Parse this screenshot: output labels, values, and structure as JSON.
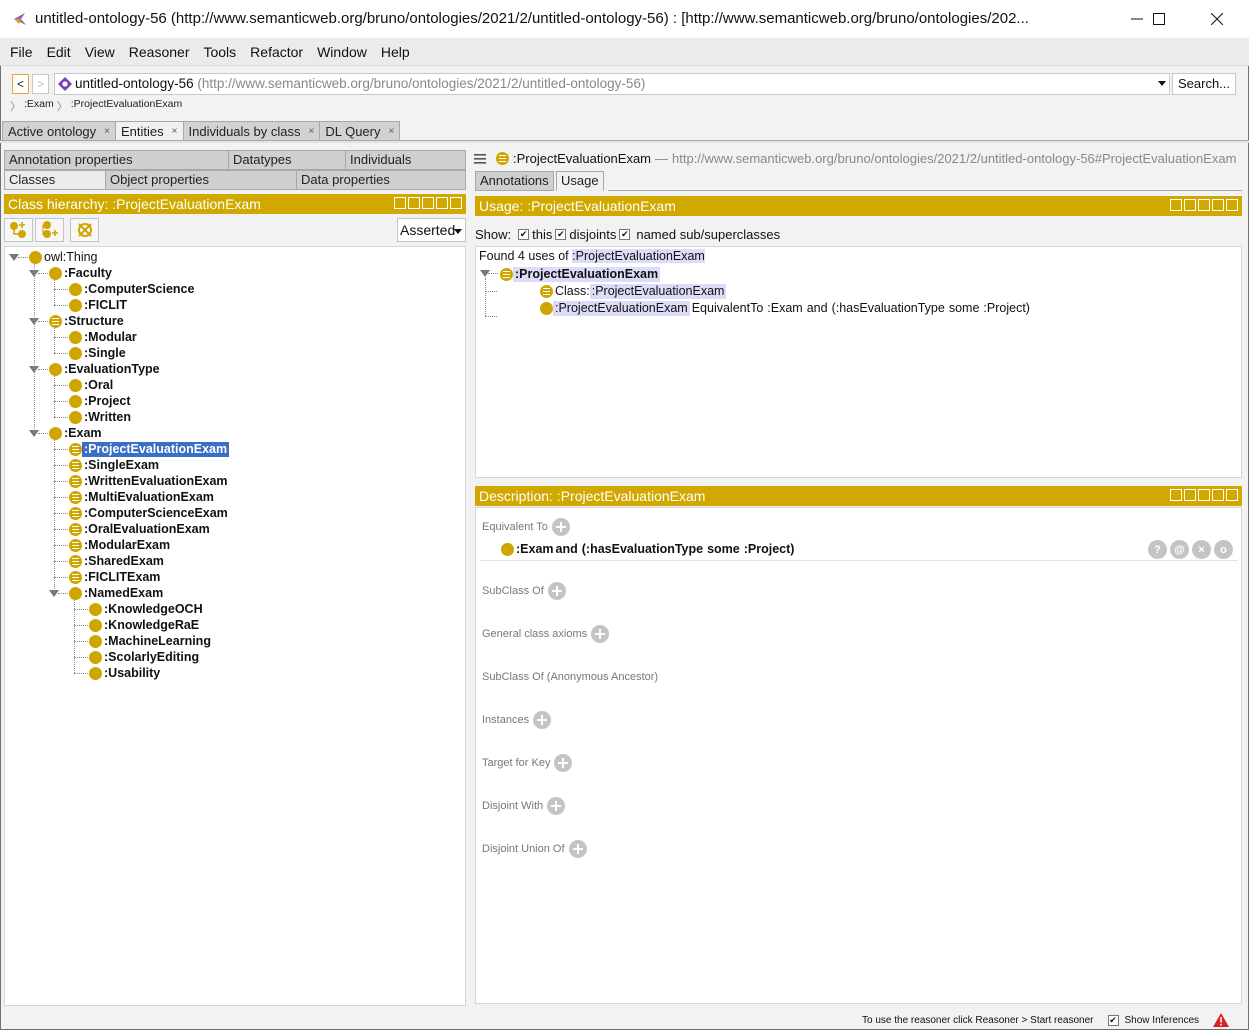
{
  "window": {
    "title": "untitled-ontology-56 (http://www.semanticweb.org/bruno/ontologies/2021/2/untitled-ontology-56)  : [http://www.semanticweb.org/bruno/ontologies/202...",
    "controls": [
      "minimize-icon",
      "maximize-icon",
      "close-icon"
    ]
  },
  "menubar": [
    "File",
    "Edit",
    "View",
    "Reasoner",
    "Tools",
    "Refactor",
    "Window",
    "Help"
  ],
  "navigation": {
    "back": "<",
    "forward": ">",
    "ontology_name": "untitled-ontology-56",
    "ontology_iri": "(http://www.semanticweb.org/bruno/ontologies/2021/2/untitled-ontology-56)",
    "search_label": "Search..."
  },
  "breadcrumb": [
    ":Exam",
    ":ProjectEvaluationExam"
  ],
  "workspace_tabs": [
    {
      "label": "Active ontology",
      "active": false
    },
    {
      "label": "Entities",
      "active": true
    },
    {
      "label": "Individuals by class",
      "active": false
    },
    {
      "label": "DL Query",
      "active": false
    }
  ],
  "entity_tabs": {
    "row1": [
      "Annotation properties",
      "Datatypes",
      "Individuals"
    ],
    "row2": [
      "Classes",
      "Object properties",
      "Data properties"
    ],
    "active": "Classes"
  },
  "class_hierarchy": {
    "header": "Class hierarchy: :ProjectEvaluationExam",
    "mode": "Asserted",
    "tools": [
      "add-subclass-icon",
      "add-sibling-class-icon",
      "delete-class-icon"
    ],
    "tree": [
      {
        "label": "owl:Thing",
        "depth": 0,
        "expanded": true,
        "bold": false,
        "defined": false
      },
      {
        "label": ":Faculty",
        "depth": 1,
        "expanded": true,
        "defined": false
      },
      {
        "label": ":ComputerScience",
        "depth": 2,
        "defined": false
      },
      {
        "label": ":FICLIT",
        "depth": 2,
        "defined": false
      },
      {
        "label": ":Structure",
        "depth": 1,
        "expanded": true,
        "defined": true
      },
      {
        "label": ":Modular",
        "depth": 2,
        "defined": false
      },
      {
        "label": ":Single",
        "depth": 2,
        "defined": false
      },
      {
        "label": ":EvaluationType",
        "depth": 1,
        "expanded": true,
        "defined": false
      },
      {
        "label": ":Oral",
        "depth": 2,
        "defined": false
      },
      {
        "label": ":Project",
        "depth": 2,
        "defined": false
      },
      {
        "label": ":Written",
        "depth": 2,
        "defined": false
      },
      {
        "label": ":Exam",
        "depth": 1,
        "expanded": true,
        "defined": false
      },
      {
        "label": ":ProjectEvaluationExam",
        "depth": 2,
        "defined": true,
        "selected": true
      },
      {
        "label": ":SingleExam",
        "depth": 2,
        "defined": true
      },
      {
        "label": ":WrittenEvaluationExam",
        "depth": 2,
        "defined": true
      },
      {
        "label": ":MultiEvaluationExam",
        "depth": 2,
        "defined": true
      },
      {
        "label": ":ComputerScienceExam",
        "depth": 2,
        "defined": true
      },
      {
        "label": ":OralEvaluationExam",
        "depth": 2,
        "defined": true
      },
      {
        "label": ":ModularExam",
        "depth": 2,
        "defined": true
      },
      {
        "label": ":SharedExam",
        "depth": 2,
        "defined": true
      },
      {
        "label": ":FICLITExam",
        "depth": 2,
        "defined": true
      },
      {
        "label": ":NamedExam",
        "depth": 2,
        "expanded": true,
        "defined": false
      },
      {
        "label": ":KnowledgeOCH",
        "depth": 3,
        "defined": false
      },
      {
        "label": ":KnowledgeRaE",
        "depth": 3,
        "defined": false
      },
      {
        "label": ":MachineLearning",
        "depth": 3,
        "defined": false
      },
      {
        "label": ":ScolarlyEditing",
        "depth": 3,
        "defined": false
      },
      {
        "label": ":Usability",
        "depth": 3,
        "defined": false
      }
    ]
  },
  "entity": {
    "name": ":ProjectEvaluationExam",
    "separator": "—",
    "iri": "http://www.semanticweb.org/bruno/ontologies/2021/2/untitled-ontology-56#ProjectEvaluationExam"
  },
  "right_tabs": [
    {
      "label": "Annotations",
      "active": false
    },
    {
      "label": "Usage",
      "active": true
    }
  ],
  "usage": {
    "header": "Usage: :ProjectEvaluationExam",
    "show_label": "Show:",
    "options": [
      {
        "label": "this",
        "checked": true
      },
      {
        "label": "disjoints",
        "checked": true
      },
      {
        "label": "named sub/superclasses",
        "checked": true
      }
    ],
    "found_prefix": "Found 4 uses of",
    "found_entity": ":ProjectEvaluationExam",
    "root": ":ProjectEvaluationExam",
    "items": [
      {
        "keyword": "Class:",
        "entity": ":ProjectEvaluationExam"
      },
      {
        "subject": ":ProjectEvaluationExam",
        "rel": "EquivalentTo",
        "a": ":Exam",
        "and": "and",
        "b": "(:hasEvaluationType",
        "some": "some",
        "c": ":Project)"
      }
    ]
  },
  "description": {
    "header": "Description: :ProjectEvaluationExam",
    "sections": [
      {
        "label": "Equivalent To",
        "addable": true
      },
      {
        "label": "SubClass Of",
        "addable": true
      },
      {
        "label": "General class axioms",
        "addable": true
      },
      {
        "label": "SubClass Of (Anonymous Ancestor)",
        "addable": false
      },
      {
        "label": "Instances",
        "addable": true
      },
      {
        "label": "Target for Key",
        "addable": true
      },
      {
        "label": "Disjoint With",
        "addable": true
      },
      {
        "label": "Disjoint Union Of",
        "addable": true
      }
    ],
    "equivalent": {
      "a": ":Exam",
      "and": "and",
      "b": "(:hasEvaluationType",
      "some": "some",
      "c": ":Project)"
    },
    "row_buttons": [
      "?",
      "@",
      "×",
      "o"
    ]
  },
  "status": {
    "message": "To use the reasoner click Reasoner > Start reasoner",
    "show_inferences_label": "Show Inferences",
    "show_inferences_checked": true
  },
  "colors": {
    "view_header": "#d0a800",
    "class_dot": "#cfa600",
    "selection": "#3a6fc4",
    "keyword_blue": "#1a5fb4",
    "keyword_teal": "#1fa7a7",
    "keyword_purple": "#b01cc0",
    "highlight": "#dcdcf8",
    "warning": "#e02020"
  }
}
